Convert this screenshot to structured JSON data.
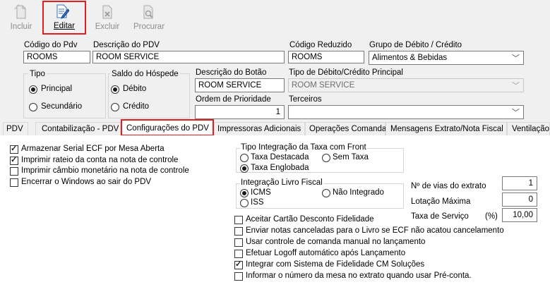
{
  "toolbar": {
    "incluir": "Incluir",
    "editar": "Editar",
    "excluir": "Excluir",
    "procurar": "Procurar"
  },
  "form": {
    "codigo_pdv_label": "Código do Pdv",
    "codigo_pdv_value": "ROOMS",
    "descricao_pdv_label": "Descrição do PDV",
    "descricao_pdv_value": "ROOM SERVICE",
    "codigo_reduzido_label": "Código Reduzido",
    "codigo_reduzido_value": "ROOMS",
    "grupo_label": "Grupo de Débito / Crédito",
    "grupo_value": "Alimentos & Bebidas",
    "tipo_label": "Tipo",
    "tipo_principal": "Principal",
    "tipo_secundario": "Secundário",
    "saldo_label": "Saldo do Hóspede",
    "saldo_debito": "Débito",
    "saldo_credito": "Crédito",
    "descricao_botao_label": "Descrição do Botão",
    "descricao_botao_value": "ROOM SERVICE",
    "tipo_debcred_label": "Tipo de Débito/Crédito Principal",
    "tipo_debcred_value": "ROOM SERVICE",
    "ordem_label": "Ordem de Prioridade",
    "ordem_value": "1",
    "terceiros_label": "Terceiros",
    "terceiros_value": ""
  },
  "tabs": [
    "PDV",
    "Contabilização - PDV",
    "Configurações do PDV",
    "Impressoras Adicionais",
    "Operações Comanda",
    "Mensagens Extrato/Nota Fiscal",
    "Ventilação"
  ],
  "config": {
    "left_checks": [
      {
        "label": "Armazenar Serial ECF por Mesa Aberta",
        "checked": true
      },
      {
        "label": "Imprimir rateio da conta na nota de controle",
        "checked": true
      },
      {
        "label": "Imprimir câmbio monetário na nota de controle",
        "checked": false
      },
      {
        "label": "Encerrar o Windows ao sair do PDV",
        "checked": false
      }
    ],
    "integracao_taxa_title": "Tipo Integração da Taxa com Front",
    "taxa_destacada": "Taxa Destacada",
    "sem_taxa": "Sem Taxa",
    "taxa_englobada": "Taxa Englobada",
    "integracao_livro_title": "Integração Livro Fiscal",
    "icms": "ICMS",
    "nao_integrado": "Não Integrado",
    "iss": "ISS",
    "n_vias_label": "Nº de vias do extrato",
    "n_vias_value": "1",
    "lotacao_label": "Lotação Máxima",
    "lotacao_value": "0",
    "taxa_servico_label": "Taxa de Serviço",
    "taxa_servico_unit": "(%)",
    "taxa_servico_value": "10,00",
    "bottom_checks": [
      {
        "label": "Aceitar Cartão Desconto Fidelidade",
        "checked": false
      },
      {
        "label": "Enviar notas canceladas para o Livro se ECF não acatou cancelamento",
        "checked": false
      },
      {
        "label": "Usar controle de comanda manual no lançamento",
        "checked": false
      },
      {
        "label": "Efetuar Logoff automático após Lançamento",
        "checked": false
      },
      {
        "label": "Integrar com Sistema de Fidelidade CM Soluções",
        "checked": true
      },
      {
        "label": "Informar o número da mesa no extrato quando usar Pré-conta.",
        "checked": false
      }
    ]
  }
}
